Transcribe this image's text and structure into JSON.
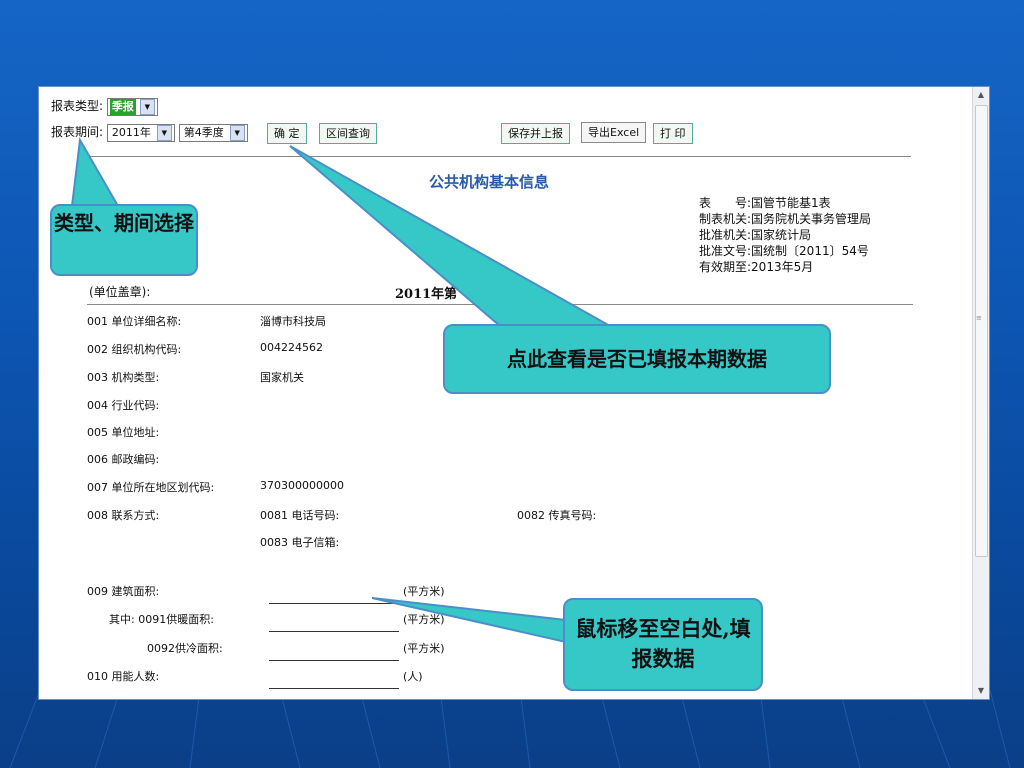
{
  "toolbar": {
    "report_type_label": "报表类型:",
    "report_type_value": "季报",
    "report_period_label": "报表期间:",
    "year_value": "2011年",
    "quarter_value": "第4季度",
    "confirm_label": "确 定",
    "range_query_label": "区间查询",
    "save_submit_label": "保存并上报",
    "export_excel_label": "导出Excel",
    "print_label": "打 印"
  },
  "form": {
    "title": "公共机构基本信息",
    "meta": [
      {
        "key": "表　　号:",
        "value": "国管节能基1表"
      },
      {
        "key": "制表机关:",
        "value": "国务院机关事务管理局"
      },
      {
        "key": "批准机关:",
        "value": "国家统计局"
      },
      {
        "key": "批准文号:",
        "value": "国统制〔2011〕54号"
      },
      {
        "key": "有效期至:",
        "value": "2013年5月"
      }
    ],
    "unit_seal_label": "(单位盖章):",
    "period_heading": "2011年第",
    "fields": [
      {
        "label": "001 单位详细名称:",
        "value": "淄博市科技局"
      },
      {
        "label": "002 组织机构代码:",
        "value": "004224562"
      },
      {
        "label": "003 机构类型:",
        "value": "国家机关"
      },
      {
        "label": "004 行业代码:",
        "value": ""
      },
      {
        "label": "005 单位地址:",
        "value": ""
      },
      {
        "label": "006 邮政编码:",
        "value": ""
      },
      {
        "label": "007 单位所在地区划代码:",
        "value": "370300000000"
      },
      {
        "label": "008 联系方式:",
        "value": "0081 电话号码:"
      }
    ],
    "fax_label": "0082 传真号码:",
    "email_label": "0083 电子信箱:",
    "area_rows": [
      {
        "label": "009 建筑面积:",
        "unit": "(平方米)",
        "value": ""
      },
      {
        "label": "其中: 0091供暖面积:",
        "unit": "(平方米)",
        "value": ""
      },
      {
        "label": "0092供冷面积:",
        "unit": "(平方米)",
        "value": ""
      },
      {
        "label": "010 用能人数:",
        "unit": "(人)",
        "value": ""
      }
    ]
  },
  "callouts": {
    "type_period": "类型、期间选择",
    "check_submitted": "点此查看是否已填报本期数据",
    "fill_data": "鼠标移至空白处,填报数据"
  },
  "colors": {
    "background": "#0d56b3",
    "callout": "#36c7c7",
    "title_blue": "#2b5aa8",
    "report_type_green": "#2c9f2c"
  }
}
